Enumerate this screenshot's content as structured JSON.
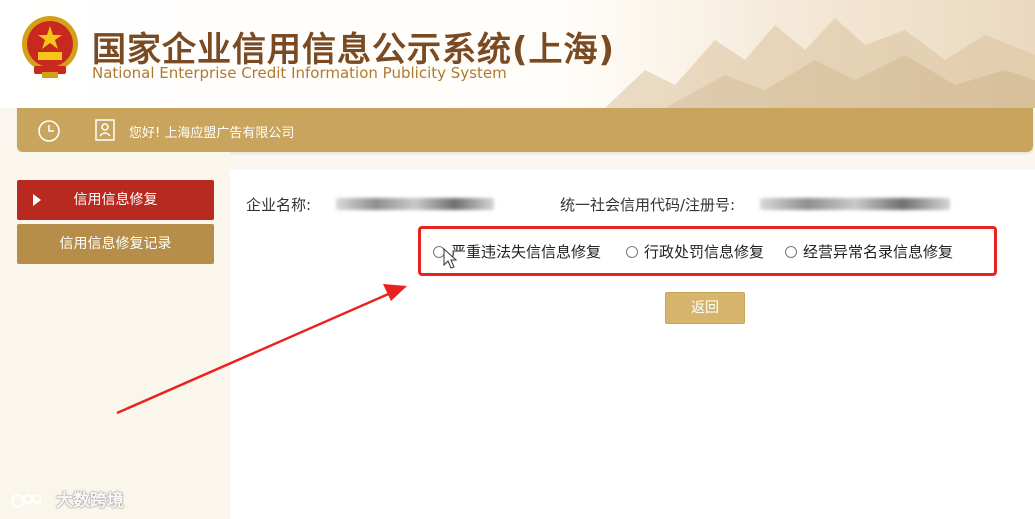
{
  "header": {
    "title_cn": "国家企业信用信息公示系统(上海)",
    "title_en": "National Enterprise Credit Information Publicity System"
  },
  "top_bar": {
    "welcome": "您好! 上海应盟广告有限公司"
  },
  "sidebar": {
    "items": [
      {
        "label": "信用信息修复",
        "active": true
      },
      {
        "label": "信用信息修复记录",
        "active": false
      }
    ]
  },
  "main": {
    "company_label": "企业名称:",
    "code_label": "统一社会信用代码/注册号:",
    "options": [
      {
        "label": "严重违法失信信息修复"
      },
      {
        "label": "行政处罚信息修复"
      },
      {
        "label": "经营异常名录信息修复"
      }
    ],
    "back_button": "返回"
  },
  "watermark": {
    "text": "大数跨境"
  },
  "colors": {
    "gold": "#c9a45c",
    "active_red": "#b8291f",
    "highlight_red": "#e8231f",
    "title_brown": "#7a4a22"
  }
}
